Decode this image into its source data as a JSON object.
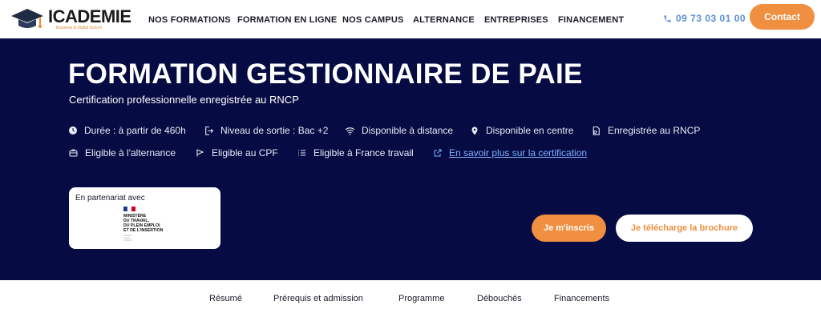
{
  "header": {
    "logo_text": "ICADEMIE",
    "logo_subtext": "Business & Digital School",
    "nav": [
      "NOS FORMATIONS",
      "FORMATION EN LIGNE",
      "NOS CAMPUS",
      "ALTERNANCE",
      "ENTREPRISES",
      "FINANCEMENT"
    ],
    "phone": "09 73 03 01 00",
    "contact_label": "Contact"
  },
  "hero": {
    "title": "FORMATION GESTIONNAIRE DE PAIE",
    "subtitle": "Certification professionnelle enregistrée au RNCP",
    "features_row1": [
      {
        "icon": "clock-icon",
        "text": "Durée : à partir de 460h"
      },
      {
        "icon": "exit-icon",
        "text": "Niveau de sortie : Bac +2"
      },
      {
        "icon": "wifi-icon",
        "text": "Disponible à distance"
      },
      {
        "icon": "location-pin-icon",
        "text": "Disponible en centre"
      },
      {
        "icon": "certificate-icon",
        "text": "Enregistrée au RNCP"
      }
    ],
    "features_row2": [
      {
        "icon": "briefcase-icon",
        "text": "Eligible à l'alternance"
      },
      {
        "icon": "flag-icon",
        "text": "Eligible au CPF"
      },
      {
        "icon": "list-icon",
        "text": "Eligible à France travail"
      },
      {
        "icon": "external-link-icon",
        "text": "En savoir plus sur la certification"
      }
    ],
    "partner_label": "En partenariat avec",
    "ministry_lines": [
      "MINISTÈRE",
      "DU TRAVAIL,",
      "DU PLEIN EMPLOI",
      "ET DE L'INSERTION"
    ],
    "register_label": "Je m'inscris",
    "brochure_label": "Je télécharge la brochure"
  },
  "tabs": [
    "Résumé",
    "Prérequis et admission",
    "Programme",
    "Débouchés",
    "Financements"
  ],
  "colors": {
    "navy": "#060b44",
    "orange": "#ef8f3f",
    "link_blue": "#7fb0ff",
    "phone_blue": "#5a8fd6"
  }
}
